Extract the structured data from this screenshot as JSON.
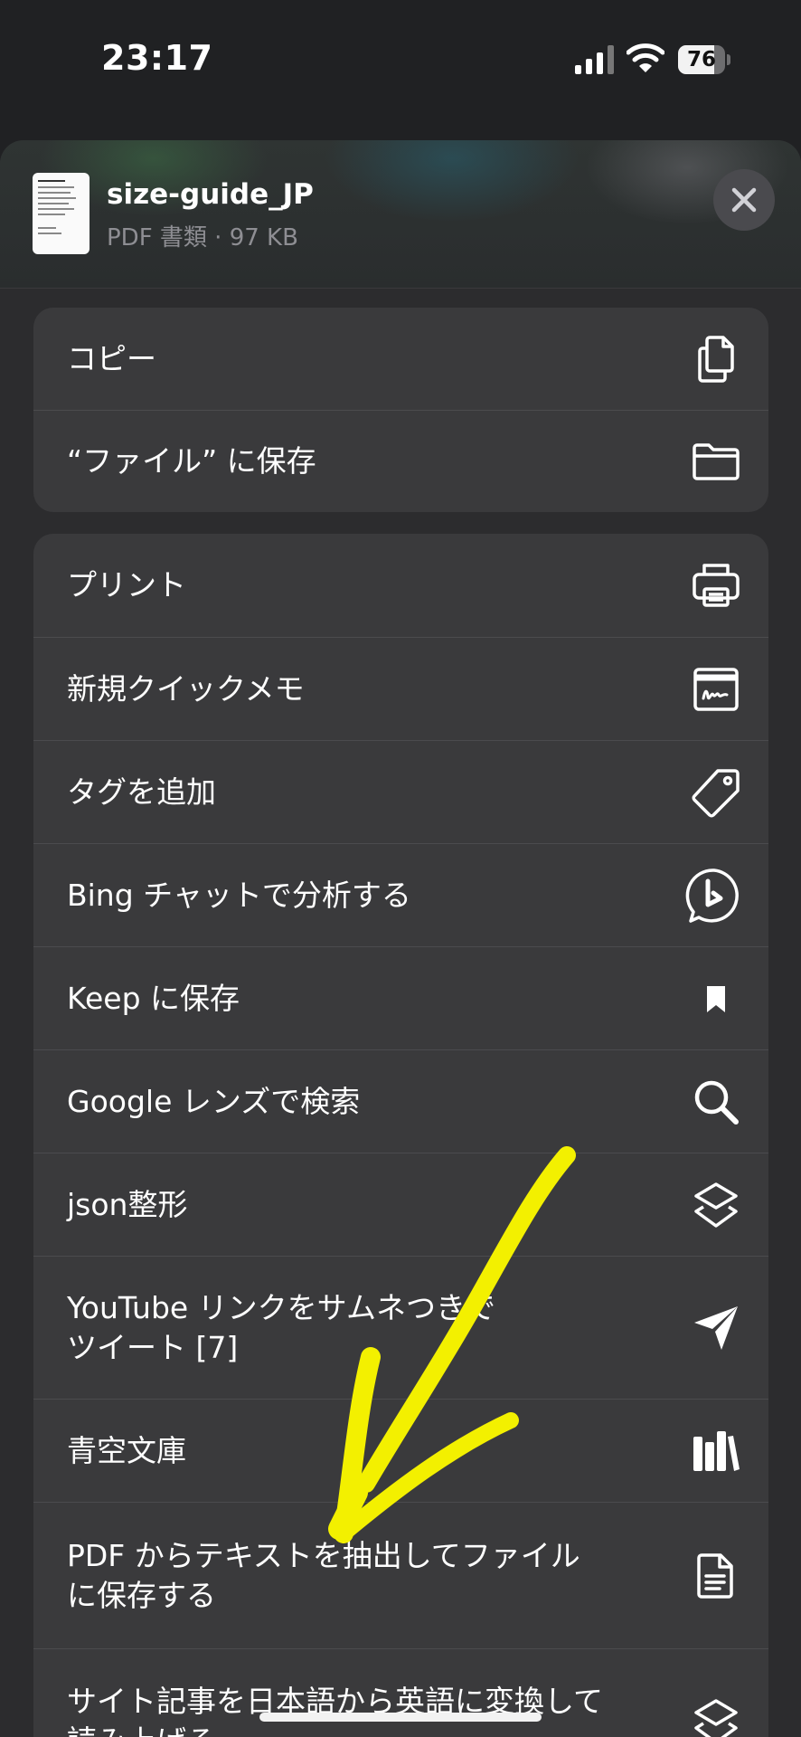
{
  "status_bar": {
    "time": "23:17",
    "battery_level": "76",
    "battery_fraction": 0.76
  },
  "file": {
    "name": "size-guide_JP",
    "meta": "PDF 書類 · 97 KB"
  },
  "group1": [
    {
      "label": "コピー",
      "icon": "copy-icon"
    },
    {
      "label": "“ファイル” に保存",
      "icon": "folder-icon"
    }
  ],
  "group2": [
    {
      "label": "プリント",
      "icon": "printer-icon"
    },
    {
      "label": "新規クイックメモ",
      "icon": "quick-note-icon"
    },
    {
      "label": "タグを追加",
      "icon": "tag-icon"
    },
    {
      "label": "Bing チャットで分析する",
      "icon": "bing-chat-icon"
    },
    {
      "label": "Keep に保存",
      "icon": "bookmark-icon"
    },
    {
      "label": "Google レンズで検索",
      "icon": "magnifier-icon"
    },
    {
      "label": "json整形",
      "icon": "shortcuts-layers-icon"
    },
    {
      "label": "YouTube リンクをサムネつきで\nツイート [7]",
      "icon": "paper-plane-icon"
    },
    {
      "label": "青空文庫",
      "icon": "books-icon"
    },
    {
      "label": "PDF からテキストを抽出してファイル\nに保存する",
      "icon": "document-icon"
    },
    {
      "label": "サイト記事を日本語から英語に変換して\n読み上げる",
      "icon": "shortcuts-layers-icon"
    }
  ],
  "colors": {
    "scribble": "#f3f000",
    "row_bg": "#3a3a3c",
    "secondary_text": "#8e8e93"
  }
}
